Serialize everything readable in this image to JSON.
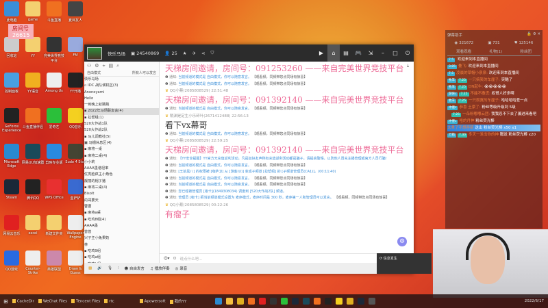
{
  "desktop": {
    "overlay_label": "房间号",
    "overlay_number": "26615",
    "icons": [
      {
        "label": "此电脑",
        "color": "#3a8ed8"
      },
      {
        "label": "game",
        "color": "#f4d070"
      },
      {
        "label": "斗鱼直播",
        "color": "#f07020"
      },
      {
        "label": "夏目友人",
        "color": "#444"
      },
      {
        "label": "回收站",
        "color": "#ccc"
      },
      {
        "label": "yy",
        "color": "#f4d070"
      },
      {
        "label": "完美世界竞技平台",
        "color": "#333"
      },
      {
        "label": "FM",
        "color": "#9ad"
      },
      {
        "label": "控制面板",
        "color": "#4aa0e0"
      },
      {
        "label": "YY语音",
        "color": "#f0b020"
      },
      {
        "label": "Among Us",
        "color": "#eee"
      },
      {
        "label": "YY开播",
        "color": "#222"
      },
      {
        "label": "GeForce Experience",
        "color": "#222"
      },
      {
        "label": "斗鱼直播伴侣",
        "color": "#f07020"
      },
      {
        "label": "爱奇艺",
        "color": "#2bbf3a"
      },
      {
        "label": "QQ音乐",
        "color": "#f4d020"
      },
      {
        "label": "Microsoft Edge",
        "color": "#2a8ad0"
      },
      {
        "label": "网易UU加速器",
        "color": "#1a4a5a"
      },
      {
        "label": "剪映专业版",
        "color": "#2a8ae0"
      },
      {
        "label": "Sudo 4 Stor",
        "color": "#443"
      },
      {
        "label": "Steam",
        "color": "#1b2838"
      },
      {
        "label": "腾讯QQ",
        "color": "#222"
      },
      {
        "label": "WPS Office",
        "color": "#e83030"
      },
      {
        "label": "金铲铲",
        "color": "#3a6ad0"
      },
      {
        "label": "网易云音乐",
        "color": "#e02020"
      },
      {
        "label": "excel",
        "color": "#f4d070"
      },
      {
        "label": "新建文件夹",
        "color": "#f4d070"
      },
      {
        "label": "Wallpaper Engine",
        "color": "#eee"
      },
      {
        "label": "QQ游戏",
        "color": "#2a6ae0"
      },
      {
        "label": "Counter-Strike",
        "color": "#eee"
      },
      {
        "label": "英雄联盟",
        "color": "#cc88aa"
      },
      {
        "label": "Draw & Guess",
        "color": "#eee"
      }
    ]
  },
  "window": {
    "channel_name": "快乐马场",
    "channel_id": "24540869",
    "online": "25",
    "header_icons": [
      "star-icon",
      "plane-icon",
      "share-icon",
      "shield-icon"
    ],
    "right_icons": [
      "video-icon",
      "home-icon",
      "list-icon",
      "gamepad-icon",
      "minimize-to-tray-icon",
      "minimize-icon",
      "maximize-icon",
      "power-icon"
    ],
    "mode_label": "自由模式",
    "mode_desc": "所有人可以发言",
    "tree": [
      {
        "label": "快乐马场",
        "sel": false
      },
      {
        "label": "▫ IDC 战队候机区(3)",
        "sel": false
      },
      {
        "label": "    Anoneyami",
        "sel": false
      },
      {
        "label": "    Hello",
        "sel": false
      },
      {
        "label": "    一到晚上就跳跳",
        "sel": false
      },
      {
        "label": "▪ 2022年马场联友会(4)",
        "sel": true
      },
      {
        "label": "▪ 拉帮组(1)",
        "sel": false
      },
      {
        "label": "  520大作战1队",
        "sel": false
      },
      {
        "label": "  520大作战2队",
        "sel": false
      },
      {
        "label": "▪ 马儿调教社(5)",
        "sel": false
      },
      {
        "label": "▣ 马栅休息区(4)",
        "sel": false
      },
      {
        "label": "▪ 麻将一桌",
        "sel": false
      },
      {
        "label": "▪ 麻将二桌(4)",
        "sel": false
      },
      {
        "label": "    小小莉",
        "sel": false
      },
      {
        "label": "    AAAA墨谐坦率",
        "sel": false
      },
      {
        "label": "    优秀脸疯主小角色",
        "sel": false
      },
      {
        "label": "    靓丽的帽子猪",
        "sel": false
      },
      {
        "label": "▪ 麻将三桌(4)",
        "sel": false
      },
      {
        "label": "    Bisolt",
        "sel": false
      },
      {
        "label": "    的哥要天",
        "sel": false
      },
      {
        "label": "    曹曹",
        "sel": false
      },
      {
        "label": "▪ 麻将a桌",
        "sel": false
      },
      {
        "label": "▪ 吃鸡8组(4)",
        "sel": false
      },
      {
        "label": "    AAAA墨",
        "sel": false
      },
      {
        "label": "    曾曾",
        "sel": false
      },
      {
        "label": "    兴子主小兔果奶",
        "sel": false
      },
      {
        "label": "    林",
        "sel": false
      },
      {
        "label": "▪ 吃鸡9组",
        "sel": false
      },
      {
        "label": "▪ 吃鸡a组",
        "sel": false
      },
      {
        "label": "▪ 吃鸡b组",
        "sel": false
      }
    ],
    "messages": [
      {
        "type": "big",
        "text": "天梯房间邀请，房间号：091253260 ——来自完美世界竞技平台"
      },
      {
        "type": "note",
        "prefix": "通知:",
        "text": "当前频道的模式是 自由模式，你可以随意发言。",
        "tail": "【观看频，同频带您点同场有惊喜】"
      },
      {
        "type": "note",
        "prefix": "通知:",
        "text": "当前频道的模式是 自由模式，你可以随意发言。",
        "tail": "【观看频，同频带您点同场有惊喜】"
      },
      {
        "type": "sender",
        "text": "QQ小蔡(2085808529)  22:51:48"
      },
      {
        "type": "big",
        "text": "天梯房间邀请，房间号：091392140 ——来自完美世界竞技平台"
      },
      {
        "type": "note",
        "prefix": "通知:",
        "text": "当前频道的模式是 自由模式，你可以随意发言。",
        "tail": "【观看频，同频带您点同场有惊喜】"
      },
      {
        "type": "sender",
        "text": "稍渊是定生小乐碎叶(2671412488)  22:56:13"
      },
      {
        "type": "bigdark",
        "text": "看下vx幕哥"
      },
      {
        "type": "note",
        "prefix": "通知:",
        "text": "当前频道的模式是 自由模式，你可以随意发言。",
        "tail": "【观看频，同频带您点同场有惊喜】"
      },
      {
        "type": "sender",
        "text": "QQ小蔡(2085808529)  22:59:25"
      },
      {
        "type": "big",
        "text": "天梯房间邀请，房间号：091392140 ——来自完美世界竞技平台"
      },
      {
        "type": "note",
        "prefix": "通知:",
        "text": "【YY安全提醒】YY官方无充值返利活动，凡是加好友声称有充值返利活动都是骗子，请提高警惕，以防他人冒充主播管理或官方人员行骗!",
        "tail": ""
      },
      {
        "type": "note",
        "prefix": "通知:",
        "text": "当前频道的模式是 自由模式，你可以随意发言。",
        "tail": "【观看频，同频带您点同场有惊喜】"
      },
      {
        "type": "note",
        "prefix": "通知:",
        "text": "[王前黑八] 的权限被 [咖萨卫] 从 [游客(U)] 变成子频道 [拉帮组] 的 [子频道管理员(CA1)]。(00:11:40)",
        "tail": ""
      },
      {
        "type": "note",
        "prefix": "通知:",
        "text": "当前频道的模式是 自由模式，你可以随意发言。",
        "tail": "【观看频，同频带您点同场有惊喜】"
      },
      {
        "type": "note",
        "prefix": "通知:",
        "text": "当前频道的模式是 自由模式，你可以随意发言。",
        "tail": "【观看频，同频带您点同场有惊喜】"
      },
      {
        "type": "note",
        "prefix": "通知:",
        "text": "您已经被管理员 [咖卡](1849308034) 调度到 [520大作战2队] 频道。",
        "tail": ""
      },
      {
        "type": "note",
        "prefix": "通知:",
        "text": "管理员 [咖卡] 把当前频道模式设置为 麦序模式，麦序时间是 300 秒，麦序第一人和管理员可以发言。",
        "tail": "【观看频，同频带您点同场有惊喜】"
      },
      {
        "type": "sender",
        "text": "QQ小蔡(2085808529)  00:22:26"
      },
      {
        "type": "big",
        "text": "有瘤子"
      }
    ],
    "input_placeholder": "说点什么吧...",
    "bottom": {
      "free_speak": "自由发言",
      "music": "播放伴奏",
      "record": "录音"
    },
    "toast": "信息发生"
  },
  "panel": {
    "title": "弹幕助手",
    "stats": [
      "321672",
      "731",
      "125146"
    ],
    "tabs": [
      "观看观看",
      "礼物(1)",
      "粉丝团"
    ],
    "rows": [
      {
        "badges": [
          "7.5"
        ],
        "name": "",
        "msg": "欢迎来到本直播间"
      },
      {
        "badges": [
          "3.85"
        ],
        "name": "叠飞:",
        "msg": "欢迎来到本直播间"
      },
      {
        "badges": [
          "7.5"
        ],
        "name": "凌晨的草帽小泉泉:",
        "msg": "欢迎来到本直播间"
      },
      {
        "badges": [
          "牧羊",
          "7.25"
        ],
        "name": "一只搞笑的车厘子:",
        "msg": "突酷了"
      },
      {
        "badges": [
          "牧羊",
          "7.25"
        ],
        "name": "DN起牛:",
        "msg": "😭😭😭😭😭"
      },
      {
        "badges": [
          "游侠c",
          "7.25"
        ],
        "name": "不能不撒谎:",
        "msg": "权哥人好多啊"
      },
      {
        "badges": [
          "牧羊",
          "7.25"
        ],
        "name": "一只寂寞的车厘子:",
        "msg": "哈哈哈哈差一点"
      },
      {
        "badges": [
          "冲撞c"
        ],
        "name": "恭喜 土豪了:",
        "msg": "粉丝等级升级到 5级"
      },
      {
        "badges": [
          "",
          "7.25"
        ],
        "name": "一朵粉嘟嘟云团:",
        "msg": "我我忍不下去了骗进来看吧"
      },
      {
        "badges": [
          "冲撞c"
        ],
        "name": "哈的月神",
        "msg": "粉丝荧光棒"
      },
      {
        "badges": [],
        "name": "太拿了不想吞箭",
        "msg": "送出 粉丝荧光棒 x50 x1"
      },
      {
        "badges": [
          "万箭",
          "7.30"
        ],
        "name": "冬天一发出你的神",
        "msg": "赠送 粉丝荧光棒 x20"
      }
    ]
  },
  "taskbar": {
    "items": [
      "CacheDir",
      "WeChat Files",
      "Tencent Files",
      "rtc",
      "Apowersoft",
      "我的YY"
    ],
    "date": "2022/6/17"
  }
}
